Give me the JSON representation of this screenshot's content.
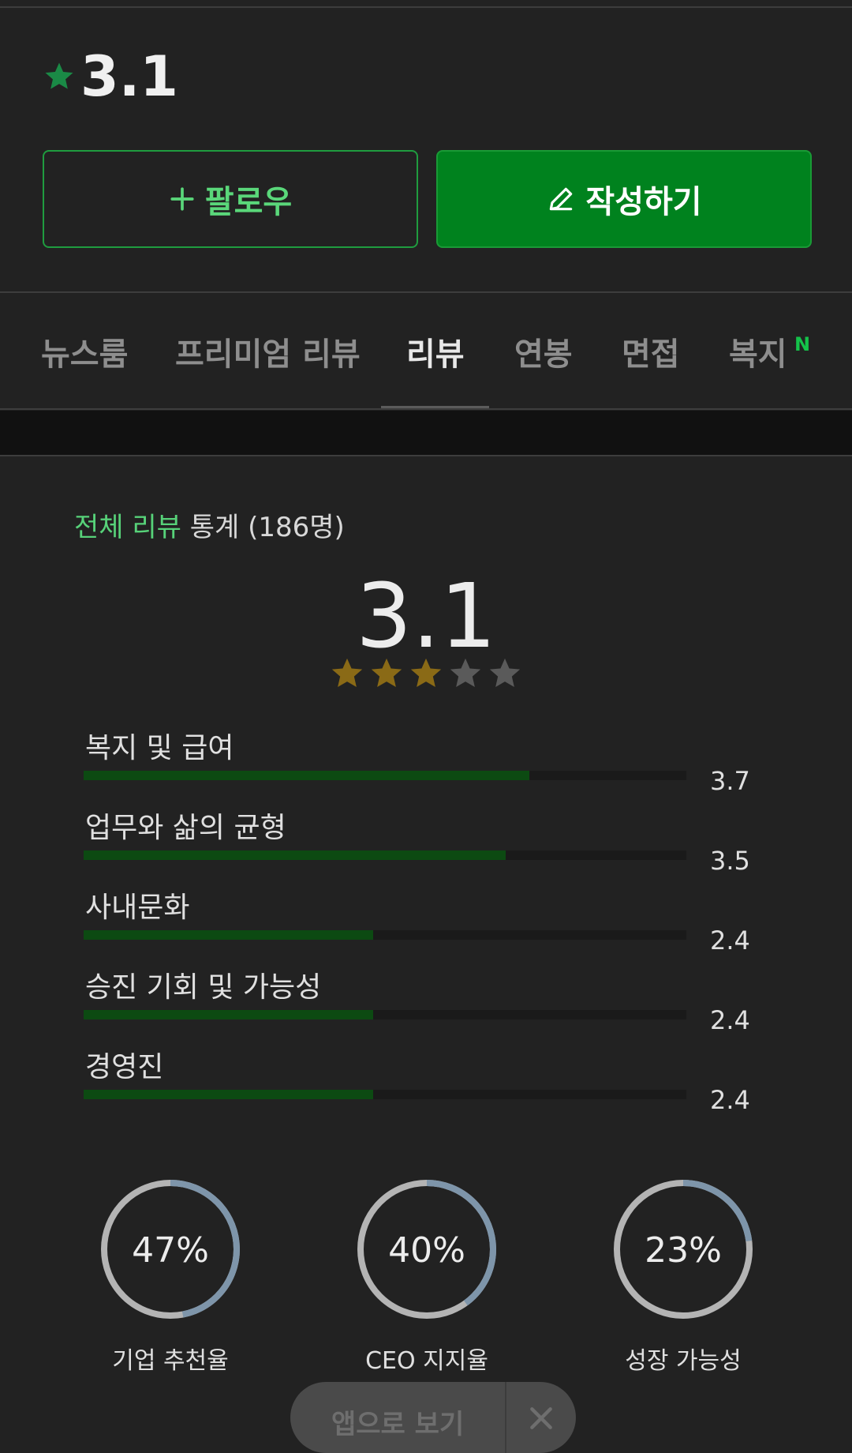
{
  "header": {
    "rating": "3.1"
  },
  "buttons": {
    "follow_label": "팔로우",
    "write_label": "작성하기"
  },
  "tabs": [
    {
      "label": "뉴스룸",
      "active": false
    },
    {
      "label": "프리미엄 리뷰",
      "active": false
    },
    {
      "label": "리뷰",
      "active": true
    },
    {
      "label": "연봉",
      "active": false
    },
    {
      "label": "면접",
      "active": false
    },
    {
      "label": "복지",
      "active": false,
      "badge": "N"
    }
  ],
  "stats": {
    "title_highlight": "전체 리뷰",
    "title_rest": " 통계 (186명)",
    "overall": "3.1",
    "stars_filled": 3,
    "stars_total": 5,
    "categories": [
      {
        "label": "복지 및 급여",
        "value": "3.7",
        "score": 3.7
      },
      {
        "label": "업무와 삶의 균형",
        "value": "3.5",
        "score": 3.5
      },
      {
        "label": "사내문화",
        "value": "2.4",
        "score": 2.4
      },
      {
        "label": "승진 기회 및 가능성",
        "value": "2.4",
        "score": 2.4
      },
      {
        "label": "경영진",
        "value": "2.4",
        "score": 2.4
      }
    ],
    "donuts": [
      {
        "percent_text": "47%",
        "percent": 47,
        "label": "기업 추천율"
      },
      {
        "percent_text": "40%",
        "percent": 40,
        "label": "CEO 지지율"
      },
      {
        "percent_text": "23%",
        "percent": 23,
        "label": "성장 가능성"
      }
    ]
  },
  "app_banner": {
    "label": "앱으로 보기"
  },
  "colors": {
    "accent_green": "#00821e",
    "text_green": "#57d279",
    "star_gold": "#8a6a16",
    "star_gray": "#5a5a5a",
    "donut_fill": "#7e95aa",
    "donut_track": "#b4b4b4"
  },
  "icons": {
    "header_star": "star-icon",
    "follow": "plus-icon",
    "write": "pencil-icon",
    "close": "close-icon"
  }
}
